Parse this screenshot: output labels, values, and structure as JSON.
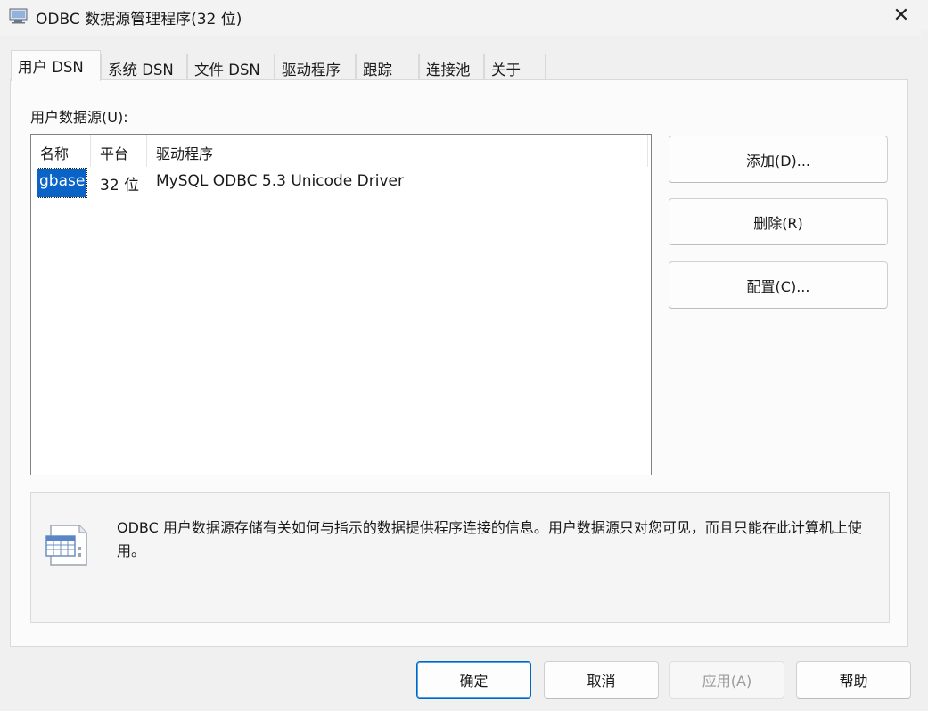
{
  "window": {
    "title": "ODBC 数据源管理程序(32 位)",
    "close_glyph": "✕"
  },
  "tabs": [
    {
      "label": "用户 DSN",
      "active": true
    },
    {
      "label": "系统 DSN",
      "active": false
    },
    {
      "label": "文件 DSN",
      "active": false
    },
    {
      "label": "驱动程序",
      "active": false
    },
    {
      "label": "跟踪",
      "active": false
    },
    {
      "label": "连接池",
      "active": false
    },
    {
      "label": "关于",
      "active": false
    }
  ],
  "user_dsn": {
    "group_label": "用户数据源(U):",
    "columns": [
      "名称",
      "平台",
      "驱动程序"
    ],
    "rows": [
      {
        "name": "gbase",
        "platform": "32 位",
        "driver": "MySQL ODBC 5.3 Unicode Driver",
        "selected": true
      }
    ]
  },
  "side_buttons": {
    "add": "添加(D)...",
    "remove": "删除(R)",
    "configure": "配置(C)..."
  },
  "info": {
    "text": "ODBC 用户数据源存储有关如何与指示的数据提供程序连接的信息。用户数据源只对您可见，而且只能在此计算机上使用。"
  },
  "footer_buttons": {
    "ok": "确定",
    "cancel": "取消",
    "apply": "应用(A)",
    "help": "帮助"
  },
  "colors": {
    "selection": "#0a64c8",
    "primary_border": "#0067c0"
  },
  "icons": {
    "title": "odbc-app-icon",
    "info": "data-table-icon"
  }
}
